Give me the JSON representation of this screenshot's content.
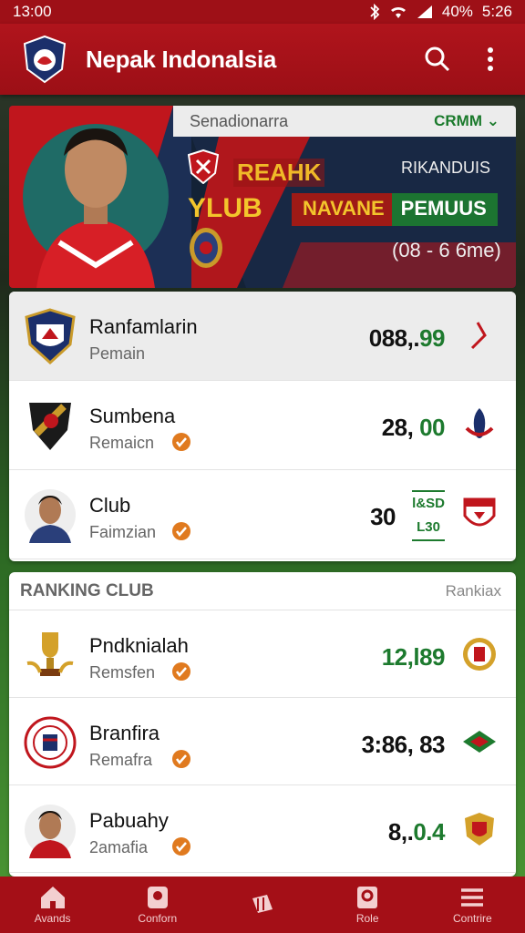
{
  "status": {
    "time": "13:00",
    "battery": "40%",
    "clock_right": "5:26"
  },
  "app": {
    "title": "Nepak Indonalsia"
  },
  "hero": {
    "subtitle": "Senadionarra",
    "dropdown": "CRMM",
    "t1": "REAHK",
    "t2": "YLUB",
    "t3": "RIKANDUIS",
    "banner_a": "NAVANE",
    "banner_b": "PEMUUS",
    "t4": "(08 - 6 6me)"
  },
  "players": [
    {
      "name": "Ranfamlarin",
      "role": "Pemain",
      "value_main": "088,.",
      "value_green": "99"
    },
    {
      "name": "Sumbena",
      "role": "Remaicn",
      "value_main": "28, ",
      "value_green": "00"
    },
    {
      "name": "Club",
      "role": "Faimzian",
      "value_main": "30",
      "mini_top": "l&SD",
      "mini_bot": "L30"
    }
  ],
  "ranking": {
    "title": "RANKING CLUB",
    "right": "Rankiax",
    "items": [
      {
        "name": "Pndknialah",
        "role": "Remsfen",
        "value_main": "",
        "value_green": "12,l89"
      },
      {
        "name": "Branfira",
        "role": "Remafra",
        "value_main": "3:86, 83",
        "value_green": ""
      },
      {
        "name": "Pabuahy",
        "role": "2amafia",
        "value_main": "8,.",
        "value_green": "0.4"
      }
    ]
  },
  "nav": [
    "Avands",
    "Conforn",
    "",
    "Role",
    "Contrire"
  ],
  "colors": {
    "primary": "#a40f17",
    "green": "#1d7a2e",
    "badge": "#e07a1f"
  }
}
